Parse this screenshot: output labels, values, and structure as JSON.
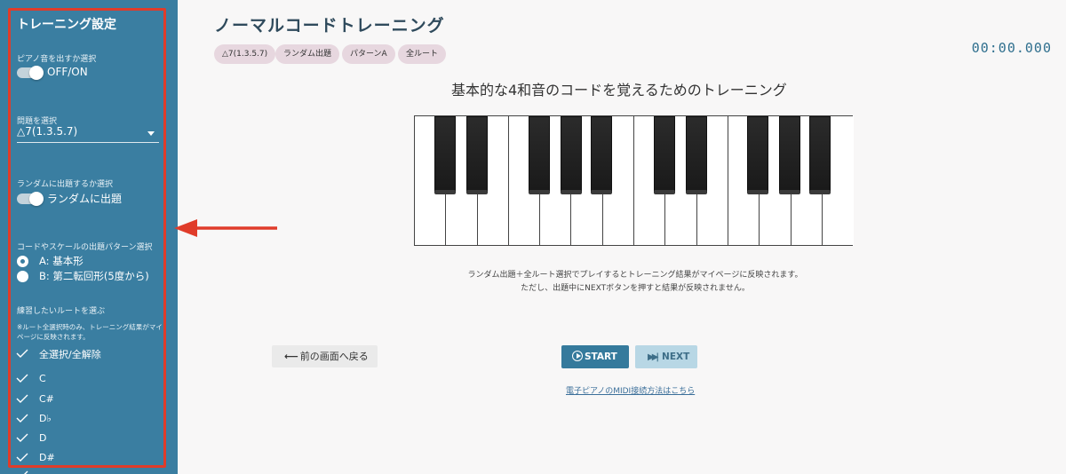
{
  "sidebar": {
    "title": "トレーニング設定",
    "piano_sound": {
      "label": "ピアノ音を出すか選択",
      "toggle_text": "OFF/ON",
      "on": true
    },
    "problem": {
      "label": "問題を選択",
      "value": "△7(1.3.5.7)"
    },
    "random": {
      "label": "ランダムに出題するか選択",
      "toggle_text": "ランダムに出題",
      "on": true
    },
    "pattern": {
      "label": "コードやスケールの出題パターン選択",
      "options": [
        {
          "label": "A: 基本形",
          "selected": true
        },
        {
          "label": "B: 第二転回形(5度から)",
          "selected": false
        }
      ]
    },
    "roots": {
      "label": "練習したいルートを選ぶ",
      "note": "※ルート全選択時のみ、トレーニング結果がマイページに反映されます。",
      "select_all": "全選択/全解除",
      "items": [
        "C",
        "C#",
        "D♭",
        "D",
        "D#"
      ]
    }
  },
  "main": {
    "title": "ノーマルコードトレーニング",
    "chips": [
      "△7(1.3.5.7)",
      "ランダム出題",
      "パターンA",
      "全ルート"
    ],
    "timer": "00:00.000",
    "subtitle": "基本的な4和音のコードを覚えるためのトレーニング",
    "info_line1": "ランダム出題＋全ルート選択でプレイするとトレーニング結果がマイページに反映されます。",
    "info_line2": "ただし、出題中にNEXTボタンを押すと結果が反映されません。",
    "back_button": "前の画面へ戻る",
    "start_button": "START",
    "next_button": "NEXT",
    "midi_link": "電子ピアノのMIDI接続方法はこちら"
  },
  "colors": {
    "sidebar_bg": "#3a7ea1",
    "highlight_outline": "#e03c2a",
    "start_button": "#357a9c",
    "next_button": "#b8d7e5",
    "chip_bg": "#e7d7df"
  }
}
